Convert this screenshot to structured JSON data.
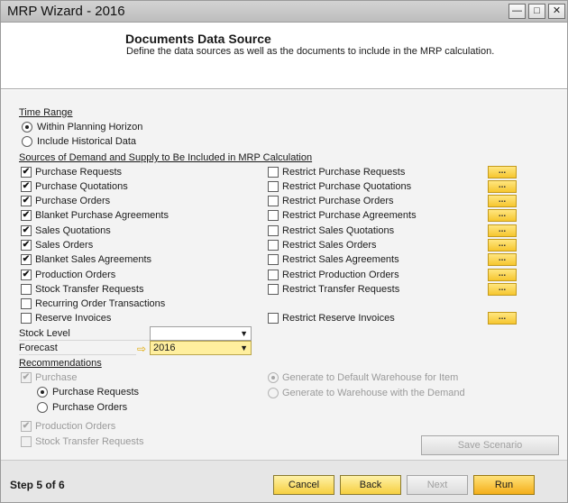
{
  "window": {
    "title": "MRP Wizard - 2016",
    "minimize": "—",
    "maximize": "□",
    "close": "✕"
  },
  "header": {
    "title": "Documents Data Source",
    "subtitle": "Define the data sources as well as the documents to include in the MRP calculation."
  },
  "time_range": {
    "label": "Time Range",
    "options": [
      {
        "label": "Within Planning Horizon",
        "selected": true
      },
      {
        "label": "Include Historical Data",
        "selected": false
      }
    ]
  },
  "sources": {
    "label": "Sources of Demand and Supply to Be Included in MRP Calculation",
    "left": [
      {
        "label": "Purchase Requests",
        "checked": true
      },
      {
        "label": "Purchase Quotations",
        "checked": true
      },
      {
        "label": "Purchase Orders",
        "checked": true
      },
      {
        "label": "Blanket Purchase Agreements",
        "checked": true
      },
      {
        "label": "Sales Quotations",
        "checked": true
      },
      {
        "label": "Sales Orders",
        "checked": true
      },
      {
        "label": "Blanket Sales Agreements",
        "checked": true
      },
      {
        "label": "Production Orders",
        "checked": true
      },
      {
        "label": "Stock Transfer Requests",
        "checked": false
      },
      {
        "label": "Recurring Order Transactions",
        "checked": false
      },
      {
        "label": "Reserve Invoices",
        "checked": false
      }
    ],
    "right": [
      {
        "label": "Restrict Purchase Requests",
        "checked": false
      },
      {
        "label": "Restrict Purchase Quotations",
        "checked": false
      },
      {
        "label": "Restrict Purchase Orders",
        "checked": false
      },
      {
        "label": "Restrict Purchase Agreements",
        "checked": false
      },
      {
        "label": "Restrict Sales Quotations",
        "checked": false
      },
      {
        "label": "Restrict Sales Orders",
        "checked": false
      },
      {
        "label": "Restrict Sales Agreements",
        "checked": false
      },
      {
        "label": "Restrict Production Orders",
        "checked": false
      },
      {
        "label": "Restrict Transfer Requests",
        "checked": false
      },
      {
        "label": "Restrict Reserve Invoices",
        "checked": false
      }
    ],
    "dots_label": "..."
  },
  "stock_level": {
    "label": "Stock Level",
    "value": ""
  },
  "forecast": {
    "label": "Forecast",
    "value": "2016"
  },
  "recommendations": {
    "label": "Recommendations",
    "purchase": {
      "label": "Purchase",
      "checked": true
    },
    "purchase_options": [
      {
        "label": "Purchase Requests",
        "selected": true
      },
      {
        "label": "Purchase Orders",
        "selected": false
      }
    ],
    "warehouse_options": [
      {
        "label": "Generate to Default Warehouse for Item",
        "selected": true
      },
      {
        "label": "Generate to Warehouse with the Demand",
        "selected": false
      }
    ],
    "production_orders": {
      "label": "Production Orders",
      "checked": true
    },
    "stock_transfer_requests": {
      "label": "Stock Transfer Requests",
      "checked": false
    },
    "save_scenario": "Save Scenario"
  },
  "footer": {
    "step": "Step 5 of 6",
    "cancel": "Cancel",
    "back": "Back",
    "next": "Next",
    "run": "Run"
  }
}
